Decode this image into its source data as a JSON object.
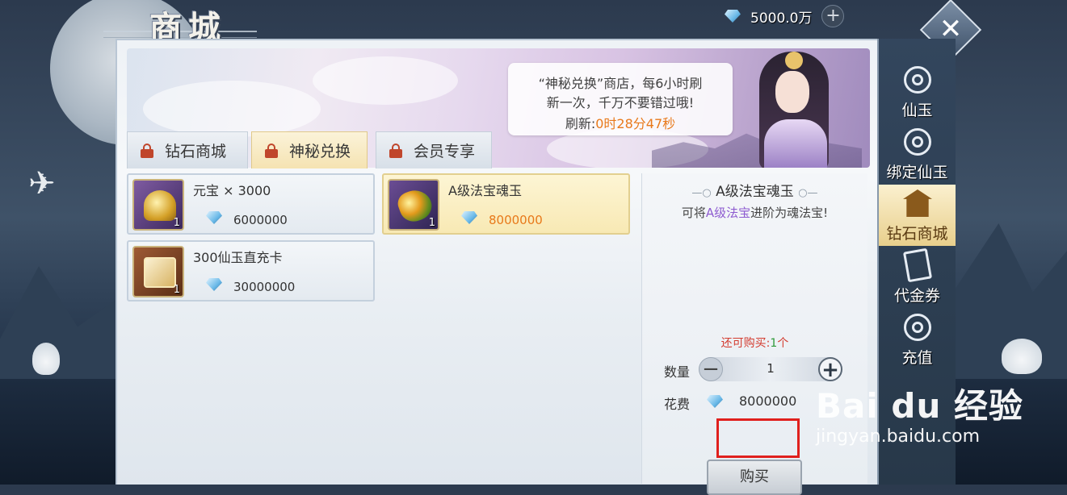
{
  "header": {
    "title": "商城",
    "currency_value": "5000.0万",
    "close_icon": "close-icon",
    "plus_icon": "plus-icon"
  },
  "banner": {
    "line1": "“神秘兑换”商店，每6小时刷",
    "line2": "新一次，千万不要错过哦!",
    "refresh_label": "刷新:",
    "refresh_time": "0时28分47秒"
  },
  "tabs": [
    {
      "label": "钻石商城",
      "active": false
    },
    {
      "label": "神秘兑换",
      "active": true
    },
    {
      "label": "会员专享",
      "active": false
    }
  ],
  "items": [
    {
      "name": "元宝 × 3000",
      "price": "6000000",
      "count": "1",
      "selected": false
    },
    {
      "name": "A级法宝魂玉",
      "price": "8000000",
      "count": "1",
      "selected": true
    },
    {
      "name": "300仙玉直充卡",
      "price": "30000000",
      "count": "1",
      "selected": false
    }
  ],
  "detail": {
    "title": "A级法宝魂玉",
    "desc_prefix": "可将",
    "desc_highlight": "A级法宝",
    "desc_suffix": "进阶为魂法宝!",
    "remain_label": "还可购买:",
    "remain_count": "1",
    "remain_unit": "个",
    "qty_label": "数量",
    "qty_value": "1",
    "cost_label": "花费",
    "cost_value": "8000000",
    "buy_label": "购买"
  },
  "sidebar": [
    {
      "label": "仙玉",
      "active": false
    },
    {
      "label": "绑定仙玉",
      "active": false
    },
    {
      "label": "钻石商城",
      "active": true
    },
    {
      "label": "代金券",
      "active": false
    },
    {
      "label": "充值",
      "active": false
    }
  ],
  "watermark": {
    "brand": "Bai du 经验",
    "url": "jingyan.baidu.com"
  },
  "colors": {
    "accent_orange": "#e8791a",
    "highlight_red": "#e0201d",
    "purple_text": "#8e5cd0",
    "green_text": "#2f9a3a"
  }
}
